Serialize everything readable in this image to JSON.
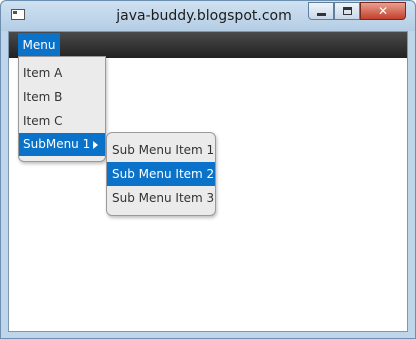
{
  "window": {
    "title": "java-buddy.blogspot.com",
    "controls": {
      "minimize_icon": "minimize-icon",
      "maximize_icon": "maximize-icon",
      "close_icon": "close-icon",
      "close_glyph": "✕"
    },
    "app_icon": "window-icon"
  },
  "menubar": {
    "menu_label": "Menu"
  },
  "menu": {
    "items": [
      {
        "label": "Item A"
      },
      {
        "label": "Item B"
      },
      {
        "label": "Item C"
      },
      {
        "label": "SubMenu 1",
        "selected": true,
        "has_submenu": true
      }
    ]
  },
  "submenu": {
    "items": [
      {
        "label": "Sub Menu Item 1"
      },
      {
        "label": "Sub Menu Item 2",
        "selected": true
      },
      {
        "label": "Sub Menu Item 3"
      }
    ]
  },
  "colors": {
    "selection": "#0a72c9",
    "menubar": "#2e2e2e",
    "menu_bg": "#ebebeb"
  }
}
